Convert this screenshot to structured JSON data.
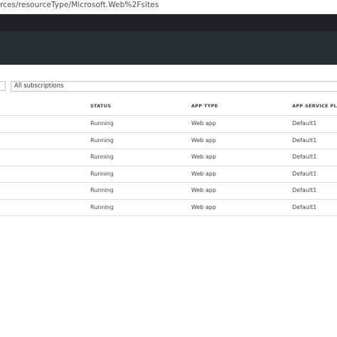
{
  "browser": {
    "url": "rces/resourceType/Microsoft.Web%2Fsites"
  },
  "filters": {
    "subscription": "All subscriptions"
  },
  "table": {
    "headers": [
      "STATUS",
      "APP TYPE",
      "APP SERVICE PLAN"
    ],
    "rows": [
      {
        "status": "Running",
        "app_type": "Web app",
        "plan": "Default1"
      },
      {
        "status": "Running",
        "app_type": "Web app",
        "plan": "Default1"
      },
      {
        "status": "Running",
        "app_type": "Web app",
        "plan": "Default1"
      },
      {
        "status": "Running",
        "app_type": "Web app",
        "plan": "Default1"
      },
      {
        "status": "Running",
        "app_type": "Web app",
        "plan": "Default1"
      },
      {
        "status": "Running",
        "app_type": "Web app",
        "plan": "Default1"
      }
    ]
  }
}
